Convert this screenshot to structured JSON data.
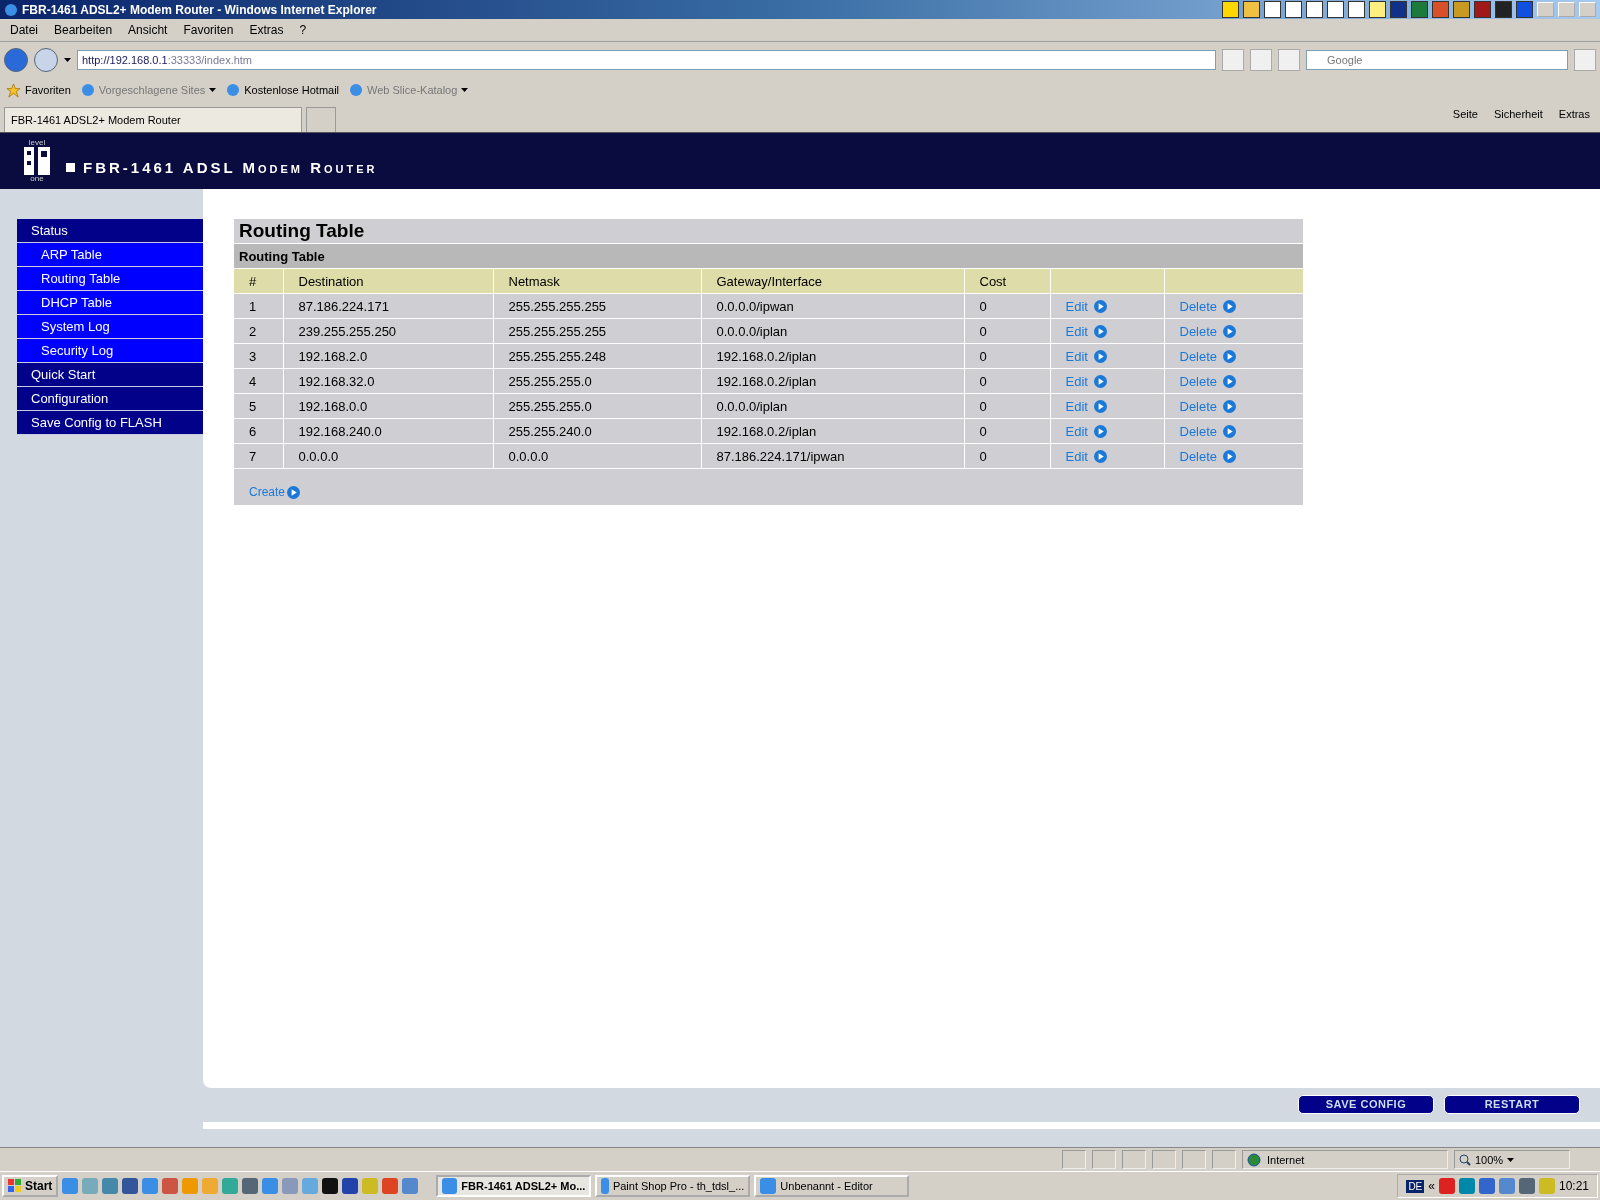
{
  "window": {
    "title": "FBR-1461 ADSL2+ Modem Router - Windows Internet Explorer"
  },
  "menu": [
    "Datei",
    "Bearbeiten",
    "Ansicht",
    "Favoriten",
    "Extras",
    "?"
  ],
  "address": {
    "host": "http://192.168.0.1",
    "path": ":33333/index.htm"
  },
  "search": {
    "placeholder": "Google"
  },
  "favorites": {
    "label": "Favoriten",
    "links": [
      {
        "label": "Vorgeschlagene Sites",
        "dropdown": true,
        "greyed": true
      },
      {
        "label": "Kostenlose Hotmail",
        "dropdown": false,
        "greyed": false
      },
      {
        "label": "Web Slice-Katalog",
        "dropdown": true,
        "greyed": true
      }
    ]
  },
  "browser_tab": {
    "title": "FBR-1461 ADSL2+ Modem Router"
  },
  "command_bar": [
    "Seite",
    "Sicherheit",
    "Extras"
  ],
  "router": {
    "logo_top": "level",
    "logo_bottom": "one",
    "title": "FBR-1461 ADSL Modem Router"
  },
  "sidebar": [
    {
      "label": "Status",
      "kind": "section"
    },
    {
      "label": "ARP Table",
      "kind": "sub"
    },
    {
      "label": "Routing Table",
      "kind": "sub"
    },
    {
      "label": "DHCP Table",
      "kind": "sub"
    },
    {
      "label": "System Log",
      "kind": "sub"
    },
    {
      "label": "Security Log",
      "kind": "sub"
    },
    {
      "label": "Quick Start",
      "kind": "section"
    },
    {
      "label": "Configuration",
      "kind": "section"
    },
    {
      "label": "Save Config to FLASH",
      "kind": "section"
    }
  ],
  "page": {
    "title": "Routing Table",
    "subtitle": "Routing Table",
    "columns": [
      "#",
      "Destination",
      "Netmask",
      "Gateway/Interface",
      "Cost"
    ],
    "rows": [
      {
        "cells": [
          "1",
          "87.186.224.171",
          "255.255.255.255",
          "0.0.0.0/ipwan",
          "0"
        ],
        "edit": "Edit",
        "delete": "Delete"
      },
      {
        "cells": [
          "2",
          "239.255.255.250",
          "255.255.255.255",
          "0.0.0.0/iplan",
          "0"
        ],
        "edit": "Edit",
        "delete": "Delete"
      },
      {
        "cells": [
          "3",
          "192.168.2.0",
          "255.255.255.248",
          "192.168.0.2/iplan",
          "0"
        ],
        "edit": "Edit",
        "delete": "Delete"
      },
      {
        "cells": [
          "4",
          "192.168.32.0",
          "255.255.255.0",
          "192.168.0.2/iplan",
          "0"
        ],
        "edit": "Edit",
        "delete": "Delete"
      },
      {
        "cells": [
          "5",
          "192.168.0.0",
          "255.255.255.0",
          "0.0.0.0/iplan",
          "0"
        ],
        "edit": "Edit",
        "delete": "Delete"
      },
      {
        "cells": [
          "6",
          "192.168.240.0",
          "255.255.240.0",
          "192.168.0.2/iplan",
          "0"
        ],
        "edit": "Edit",
        "delete": "Delete"
      },
      {
        "cells": [
          "7",
          "0.0.0.0",
          "0.0.0.0",
          "87.186.224.171/ipwan",
          "0"
        ],
        "edit": "Edit",
        "delete": "Delete"
      }
    ],
    "create": "Create"
  },
  "buttons": [
    "SAVE CONFIG",
    "RESTART"
  ],
  "status_bar": {
    "zone": "Internet",
    "zoom": "100%"
  },
  "taskbar": {
    "start": "Start",
    "tasks": [
      {
        "label": "FBR-1461 ADSL2+ Mo...",
        "selected": true
      },
      {
        "label": "Paint Shop Pro - th_tdsl_...",
        "selected": false
      },
      {
        "label": "Unbenannt - Editor",
        "selected": false
      }
    ],
    "language": "DE",
    "tray_expand": "«",
    "clock": "10:21"
  }
}
